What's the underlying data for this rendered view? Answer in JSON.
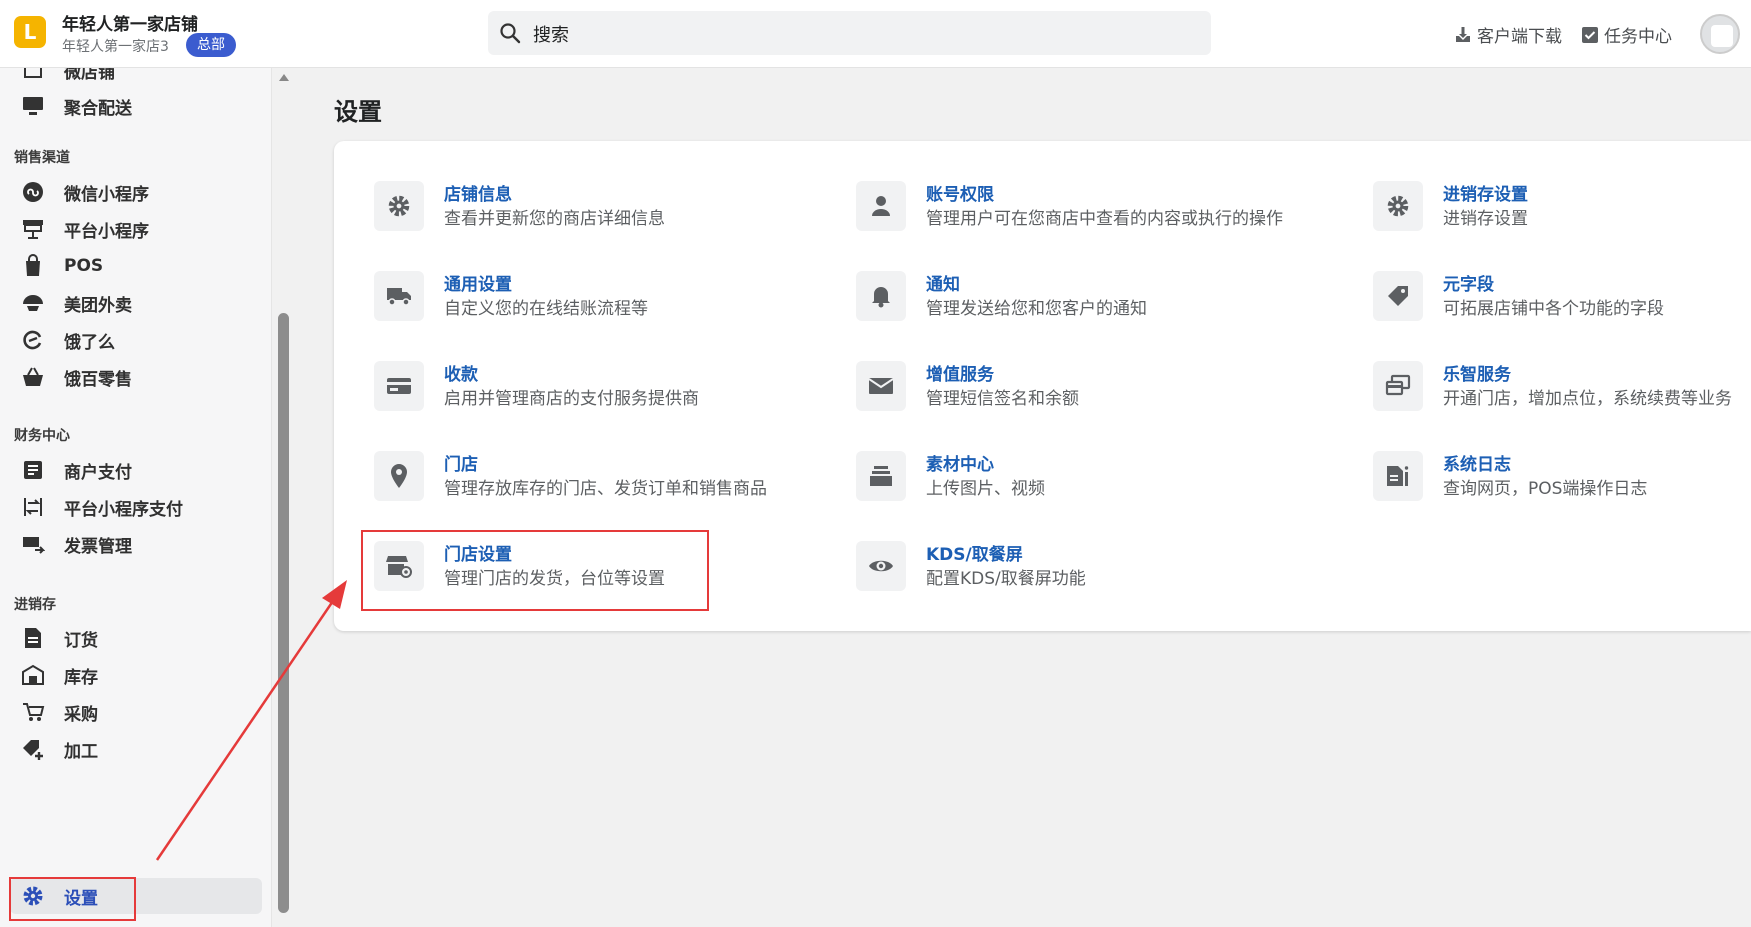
{
  "header": {
    "logo_letter": "L",
    "store_name": "年轻人第一家店铺",
    "store_sub": "年轻人第一家店3",
    "badge": "总部",
    "search_placeholder": "搜索",
    "download_label": "客户端下载",
    "tasks_label": "任务中心"
  },
  "sidebar": {
    "items_top": [
      {
        "label": "微店铺",
        "icon": "storefront-icon"
      },
      {
        "label": "聚合配送",
        "icon": "monitor-icon"
      }
    ],
    "sections": [
      {
        "title": "销售渠道",
        "items": [
          {
            "label": "微信小程序",
            "icon": "mini-program-icon"
          },
          {
            "label": "平台小程序",
            "icon": "shop-stand-icon"
          },
          {
            "label": "POS",
            "icon": "bag-icon"
          },
          {
            "label": "美团外卖",
            "icon": "meituan-icon"
          },
          {
            "label": "饿了么",
            "icon": "eleme-icon"
          },
          {
            "label": "饿百零售",
            "icon": "basket-icon"
          }
        ]
      },
      {
        "title": "财务中心",
        "items": [
          {
            "label": "商户支付",
            "icon": "document-lines-icon"
          },
          {
            "label": "平台小程序支付",
            "icon": "transfer-icon"
          },
          {
            "label": "发票管理",
            "icon": "invoice-icon"
          }
        ]
      },
      {
        "title": "进销存",
        "items": [
          {
            "label": "订货",
            "icon": "order-file-icon"
          },
          {
            "label": "库存",
            "icon": "warehouse-icon"
          },
          {
            "label": "采购",
            "icon": "cart-icon"
          },
          {
            "label": "加工",
            "icon": "tag-plus-icon"
          }
        ]
      }
    ],
    "active_item": {
      "label": "设置",
      "icon": "gear-icon"
    }
  },
  "main": {
    "title": "设置",
    "settings": [
      {
        "title": "店铺信息",
        "desc": "查看并更新您的商店详细信息",
        "icon": "gear-icon"
      },
      {
        "title": "账号权限",
        "desc": "管理用户可在您商店中查看的内容或执行的操作",
        "icon": "person-icon"
      },
      {
        "title": "进销存设置",
        "desc": "进销存设置",
        "icon": "gear-icon"
      },
      {
        "title": "通用设置",
        "desc": "自定义您的在线结账流程等",
        "icon": "truck-icon"
      },
      {
        "title": "通知",
        "desc": "管理发送给您和您客户的通知",
        "icon": "bell-icon"
      },
      {
        "title": "元字段",
        "desc": "可拓展店铺中各个功能的字段",
        "icon": "tag-icon"
      },
      {
        "title": "收款",
        "desc": "启用并管理商店的支付服务提供商",
        "icon": "credit-card-icon"
      },
      {
        "title": "增值服务",
        "desc": "管理短信签名和余额",
        "icon": "envelope-icon"
      },
      {
        "title": "乐智服务",
        "desc": "开通门店，增加点位，系统续费等业务",
        "icon": "cards-icon"
      },
      {
        "title": "门店",
        "desc": "管理存放库存的门店、发货订单和销售商品",
        "icon": "location-pin-icon"
      },
      {
        "title": "素材中心",
        "desc": "上传图片、视频",
        "icon": "stack-icon"
      },
      {
        "title": "系统日志",
        "desc": "查询网页，POS端操作日志",
        "icon": "log-icon"
      },
      {
        "title": "门店设置",
        "desc": "管理门店的发货，台位等设置",
        "icon": "store-settings-icon"
      },
      {
        "title": "KDS/取餐屏",
        "desc": "配置KDS/取餐屏功能",
        "icon": "eye-icon"
      }
    ]
  },
  "colors": {
    "accent": "#1d5fb4",
    "badge": "#3b5ccf",
    "annotation": "#e53a3a",
    "logo": "#f5b400"
  }
}
